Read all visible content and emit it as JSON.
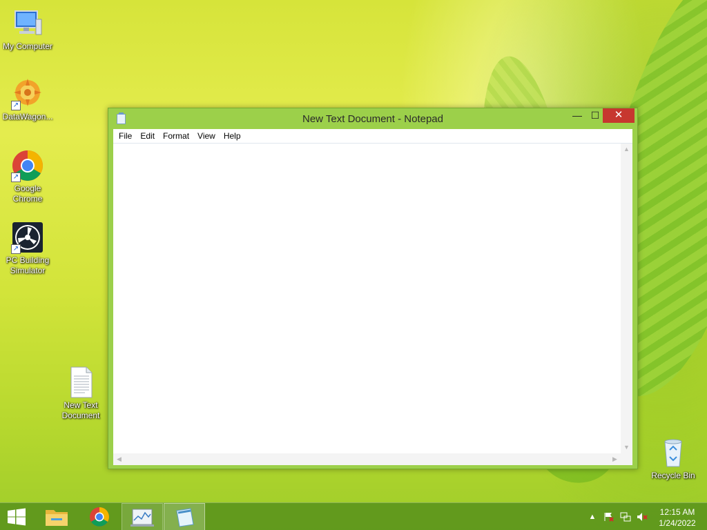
{
  "desktop": {
    "icons": [
      {
        "label": "My Computer"
      },
      {
        "label": "DataWagon..."
      },
      {
        "label": "Google Chrome"
      },
      {
        "label": "PC Building Simulator"
      },
      {
        "label": "New Text Document"
      },
      {
        "label": "Recycle Bin"
      }
    ]
  },
  "window": {
    "title": "New Text Document - Notepad",
    "close_glyph": "✕",
    "min_glyph": "—",
    "max_glyph": "☐",
    "menu": [
      "File",
      "Edit",
      "Format",
      "View",
      "Help"
    ],
    "content": ""
  },
  "taskbar": {
    "items": [
      "Start",
      "File Explorer",
      "Google Chrome",
      "Resource Monitor",
      "Notepad"
    ],
    "active": "Notepad",
    "tray": [
      "show-hidden-icons",
      "action-center-flag",
      "network",
      "volume-muted"
    ],
    "clock": {
      "time": "12:15 AM",
      "date": "1/24/2022"
    }
  }
}
